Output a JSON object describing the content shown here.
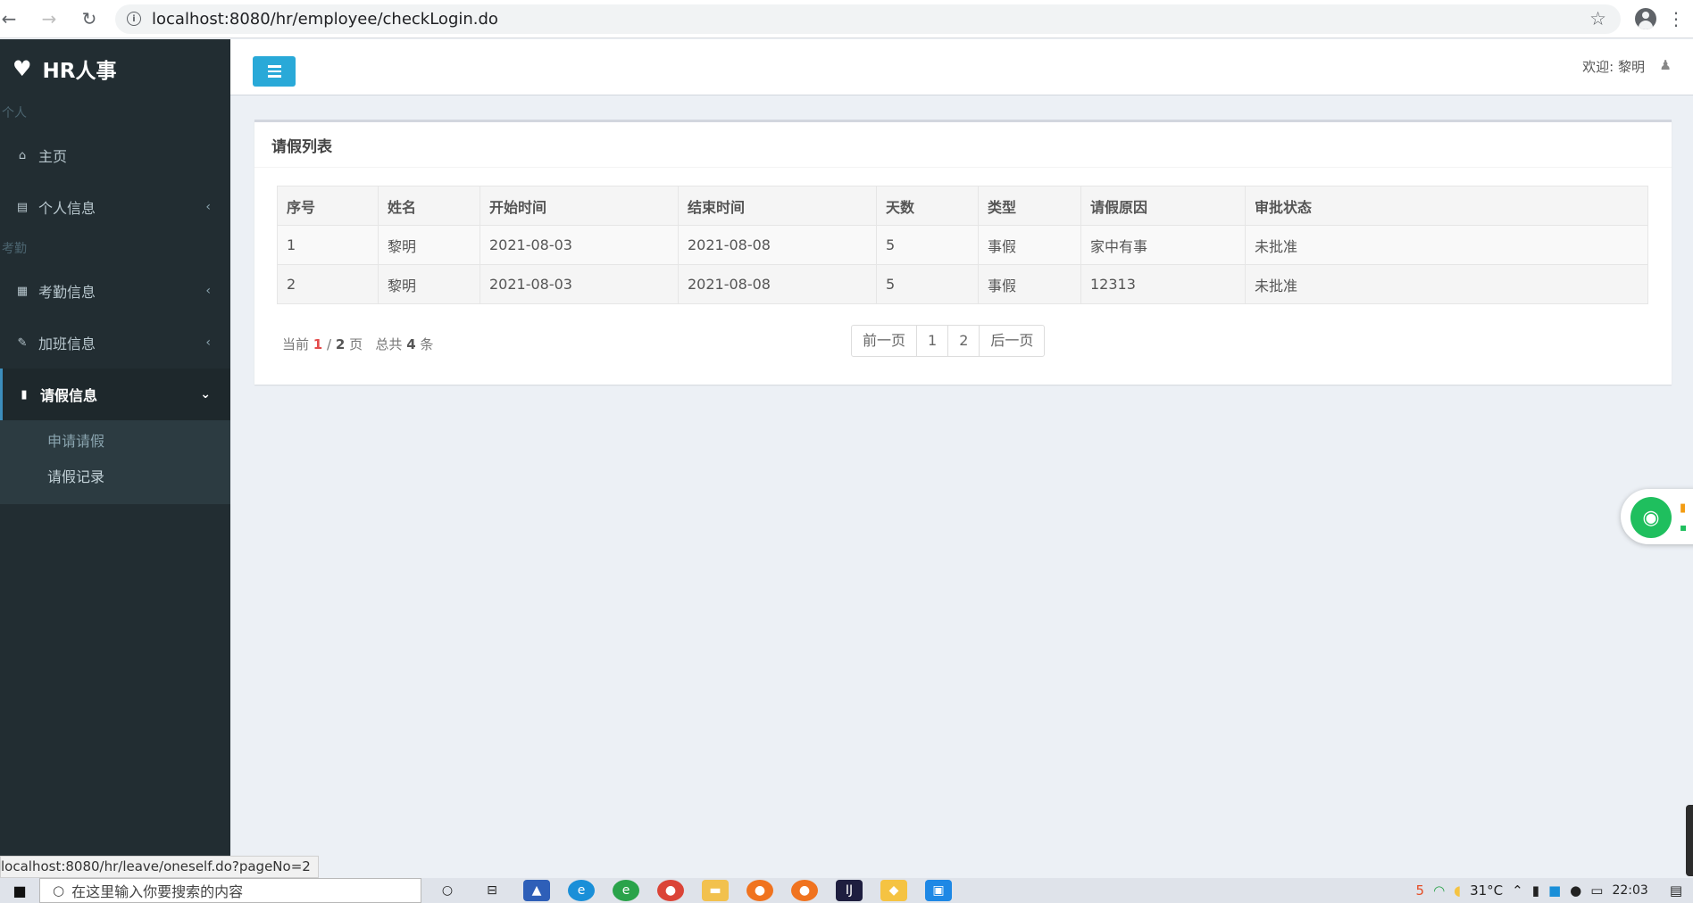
{
  "browser": {
    "back_glyph": "←",
    "forward_glyph": "→",
    "reload_glyph": "↻",
    "info_glyph": "i",
    "url": "localhost:8080/hr/employee/checkLogin.do",
    "star_glyph": "☆",
    "menu_glyph": "⋮"
  },
  "sidebar": {
    "logo_icon": "♥",
    "logo_text": "HR人事",
    "sections": {
      "personal_header": "个人",
      "attendance_header": "考勤"
    },
    "items": [
      {
        "label": "主页",
        "icon": "home-icon",
        "icon_glyph": "⌂",
        "arrow": ""
      },
      {
        "label": "个人信息",
        "icon": "id-card-icon",
        "icon_glyph": "▤",
        "arrow": "‹"
      },
      {
        "label": "考勤信息",
        "icon": "calendar-icon",
        "icon_glyph": "▦",
        "arrow": "‹"
      },
      {
        "label": "加班信息",
        "icon": "edit-icon",
        "icon_glyph": "✎",
        "arrow": "‹"
      },
      {
        "label": "请假信息",
        "icon": "bookmark-icon",
        "icon_glyph": "▮",
        "arrow": "⌄"
      }
    ],
    "submenu": [
      {
        "label": "申请请假"
      },
      {
        "label": "请假记录"
      }
    ]
  },
  "header": {
    "welcome": "欢迎: 黎明",
    "user_icon": "user-icon",
    "user_glyph": "♟"
  },
  "leave_list": {
    "title": "请假列表",
    "columns": [
      "序号",
      "姓名",
      "开始时间",
      "结束时间",
      "天数",
      "类型",
      "请假原因",
      "审批状态"
    ],
    "rows": [
      [
        "1",
        "黎明",
        "2021-08-03",
        "2021-08-08",
        "5",
        "事假",
        "家中有事",
        "未批准"
      ],
      [
        "2",
        "黎明",
        "2021-08-03",
        "2021-08-08",
        "5",
        "事假",
        "12313",
        "未批准"
      ]
    ]
  },
  "pager": {
    "prefix": "当前",
    "current": "1",
    "sep": "/",
    "total_pages": "2",
    "page_word": "页",
    "total_prefix": "总共",
    "total": "4",
    "total_suffix": "条",
    "prev": "前一页",
    "pages": [
      "1",
      "2"
    ],
    "next": "后一页"
  },
  "status_link": "localhost:8080/hr/leave/oneself.do?pageNo=2",
  "taskbar": {
    "search_placeholder": "在这里输入你要搜索的内容",
    "search_glyph": "○",
    "temperature": "31°C",
    "time": "22:03"
  },
  "colors": {
    "sidebar_bg": "#222d32",
    "accent": "#29a9d8",
    "current_page": "#e34b4b",
    "wifi": "#1fbf5e"
  }
}
